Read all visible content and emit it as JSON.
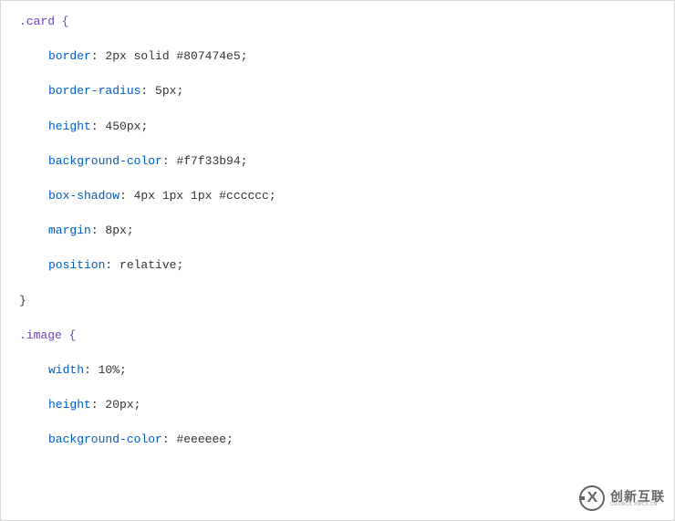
{
  "code": {
    "rule1": {
      "selector": ".card {",
      "props": [
        {
          "indent": true,
          "name": "border",
          "value": "2px solid #807474e5"
        },
        {
          "indent": true,
          "name": "border-radius",
          "value": "5px"
        },
        {
          "indent": true,
          "name": "height",
          "value": "450px"
        },
        {
          "indent": true,
          "name": "background-color",
          "value": "#f7f33b94"
        },
        {
          "indent": true,
          "name": "box-shadow",
          "value": "4px 1px 1px #cccccc"
        },
        {
          "indent": true,
          "name": "margin",
          "value": "8px"
        },
        {
          "indent": true,
          "name": "position",
          "value": "relative"
        }
      ],
      "close": "}"
    },
    "rule2": {
      "selector": ".image {",
      "props": [
        {
          "indent": true,
          "name": "width",
          "value": "10%"
        },
        {
          "indent": true,
          "name": "height",
          "value": "20px"
        },
        {
          "indent": true,
          "name": "background-color",
          "value": "#eeeeee"
        }
      ]
    }
  },
  "watermark": {
    "logo_letter": "X",
    "brand": "创新互联",
    "tagline": "CDXWCX  XWCX.CN"
  }
}
